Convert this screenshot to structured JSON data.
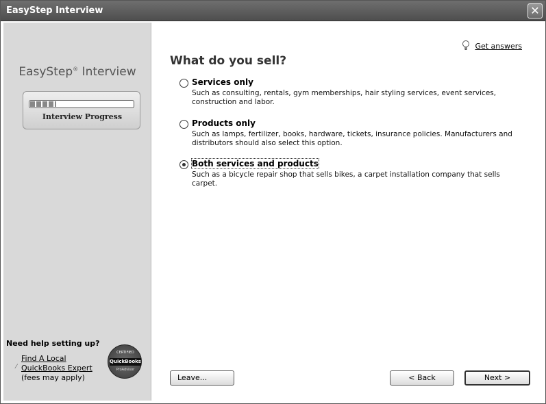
{
  "window": {
    "title": "EasyStep Interview",
    "close_label": "✕"
  },
  "sidebar": {
    "brand": "EasyStep",
    "brand_mark": "®",
    "brand_suffix": "Interview",
    "progress": {
      "label": "Interview Progress",
      "fraction": 0.25
    },
    "help": {
      "heading": "Need help setting up?",
      "link_line1": "Find A Local",
      "link_line2": "QuickBooks Expert",
      "note": "(fees may apply)",
      "badge": {
        "top": "CERTIFIED",
        "middle": "QuickBooks",
        "bottom": "ProAdvisor"
      }
    }
  },
  "main": {
    "get_answers": "Get answers",
    "question": "What do you sell?",
    "options": [
      {
        "title": "Services only",
        "description": "Such as consulting, rentals, gym memberships, hair styling services, event services, construction and labor.",
        "selected": false
      },
      {
        "title": "Products only",
        "description": "Such as lamps, fertilizer, books, hardware, tickets, insurance policies. Manufacturers and distributors should also select this option.",
        "selected": false
      },
      {
        "title": "Both services and products",
        "description": "Such as a bicycle repair shop that sells bikes, a carpet installation company that sells carpet.",
        "selected": true
      }
    ]
  },
  "buttons": {
    "leave": "Leave...",
    "back": "< Back",
    "next": "Next >"
  },
  "colors": {
    "sidebar": "#d9d9d9",
    "titlebar": "#5e5e5e"
  }
}
